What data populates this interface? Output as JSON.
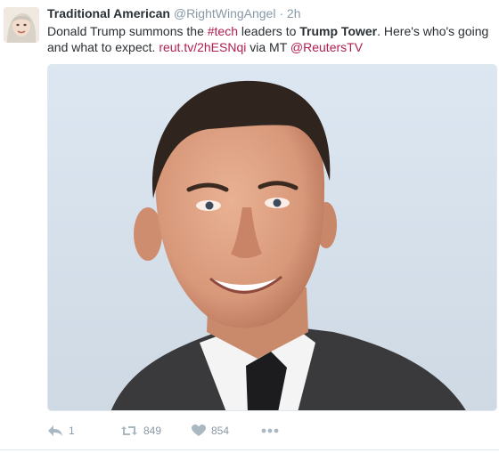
{
  "tweet": {
    "display_name": "Traditional American",
    "handle": "@RightWingAngel",
    "separator": "·",
    "time": "2h",
    "text_parts": {
      "t1": "Donald Trump summons the ",
      "hashtag": "#tech",
      "t2": " leaders to ",
      "bold": "Trump Tower",
      "t3": ". Here's who's going and what to expect. ",
      "link": "reut.tv/2hESNqi",
      "t4": " via MT  ",
      "mention": "@ReutersTV"
    },
    "image": {
      "kind": "photo",
      "subject": "man-portrait"
    },
    "actions": {
      "reply_count": "1",
      "retweet_count": "849",
      "like_count": "854"
    }
  },
  "colors": {
    "text": "#292f33",
    "muted": "#8899a6",
    "link": "#b0204f",
    "icon": "#aab8c2"
  },
  "icons": {
    "reply": "reply-icon",
    "retweet": "retweet-icon",
    "like": "heart-icon",
    "more": "more-dots-icon"
  }
}
